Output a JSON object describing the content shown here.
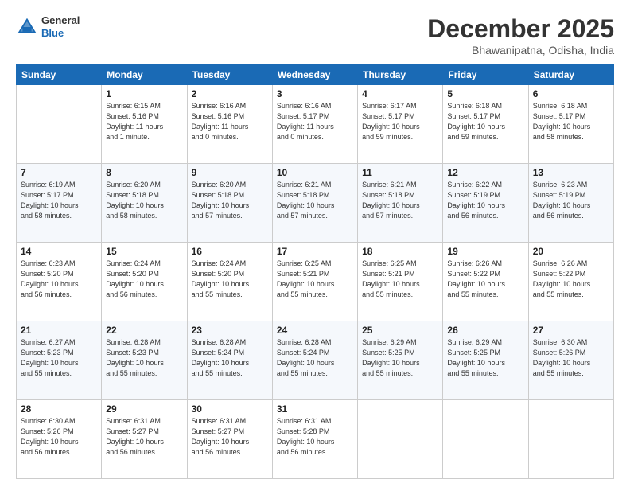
{
  "header": {
    "logo": {
      "line1": "General",
      "line2": "Blue"
    },
    "title": "December 2025",
    "location": "Bhawanipatna, Odisha, India"
  },
  "columns": [
    "Sunday",
    "Monday",
    "Tuesday",
    "Wednesday",
    "Thursday",
    "Friday",
    "Saturday"
  ],
  "weeks": [
    [
      {
        "day": "",
        "info": ""
      },
      {
        "day": "1",
        "info": "Sunrise: 6:15 AM\nSunset: 5:16 PM\nDaylight: 11 hours\nand 1 minute."
      },
      {
        "day": "2",
        "info": "Sunrise: 6:16 AM\nSunset: 5:16 PM\nDaylight: 11 hours\nand 0 minutes."
      },
      {
        "day": "3",
        "info": "Sunrise: 6:16 AM\nSunset: 5:17 PM\nDaylight: 11 hours\nand 0 minutes."
      },
      {
        "day": "4",
        "info": "Sunrise: 6:17 AM\nSunset: 5:17 PM\nDaylight: 10 hours\nand 59 minutes."
      },
      {
        "day": "5",
        "info": "Sunrise: 6:18 AM\nSunset: 5:17 PM\nDaylight: 10 hours\nand 59 minutes."
      },
      {
        "day": "6",
        "info": "Sunrise: 6:18 AM\nSunset: 5:17 PM\nDaylight: 10 hours\nand 58 minutes."
      }
    ],
    [
      {
        "day": "7",
        "info": "Sunrise: 6:19 AM\nSunset: 5:17 PM\nDaylight: 10 hours\nand 58 minutes."
      },
      {
        "day": "8",
        "info": "Sunrise: 6:20 AM\nSunset: 5:18 PM\nDaylight: 10 hours\nand 58 minutes."
      },
      {
        "day": "9",
        "info": "Sunrise: 6:20 AM\nSunset: 5:18 PM\nDaylight: 10 hours\nand 57 minutes."
      },
      {
        "day": "10",
        "info": "Sunrise: 6:21 AM\nSunset: 5:18 PM\nDaylight: 10 hours\nand 57 minutes."
      },
      {
        "day": "11",
        "info": "Sunrise: 6:21 AM\nSunset: 5:18 PM\nDaylight: 10 hours\nand 57 minutes."
      },
      {
        "day": "12",
        "info": "Sunrise: 6:22 AM\nSunset: 5:19 PM\nDaylight: 10 hours\nand 56 minutes."
      },
      {
        "day": "13",
        "info": "Sunrise: 6:23 AM\nSunset: 5:19 PM\nDaylight: 10 hours\nand 56 minutes."
      }
    ],
    [
      {
        "day": "14",
        "info": "Sunrise: 6:23 AM\nSunset: 5:20 PM\nDaylight: 10 hours\nand 56 minutes."
      },
      {
        "day": "15",
        "info": "Sunrise: 6:24 AM\nSunset: 5:20 PM\nDaylight: 10 hours\nand 56 minutes."
      },
      {
        "day": "16",
        "info": "Sunrise: 6:24 AM\nSunset: 5:20 PM\nDaylight: 10 hours\nand 55 minutes."
      },
      {
        "day": "17",
        "info": "Sunrise: 6:25 AM\nSunset: 5:21 PM\nDaylight: 10 hours\nand 55 minutes."
      },
      {
        "day": "18",
        "info": "Sunrise: 6:25 AM\nSunset: 5:21 PM\nDaylight: 10 hours\nand 55 minutes."
      },
      {
        "day": "19",
        "info": "Sunrise: 6:26 AM\nSunset: 5:22 PM\nDaylight: 10 hours\nand 55 minutes."
      },
      {
        "day": "20",
        "info": "Sunrise: 6:26 AM\nSunset: 5:22 PM\nDaylight: 10 hours\nand 55 minutes."
      }
    ],
    [
      {
        "day": "21",
        "info": "Sunrise: 6:27 AM\nSunset: 5:23 PM\nDaylight: 10 hours\nand 55 minutes."
      },
      {
        "day": "22",
        "info": "Sunrise: 6:28 AM\nSunset: 5:23 PM\nDaylight: 10 hours\nand 55 minutes."
      },
      {
        "day": "23",
        "info": "Sunrise: 6:28 AM\nSunset: 5:24 PM\nDaylight: 10 hours\nand 55 minutes."
      },
      {
        "day": "24",
        "info": "Sunrise: 6:28 AM\nSunset: 5:24 PM\nDaylight: 10 hours\nand 55 minutes."
      },
      {
        "day": "25",
        "info": "Sunrise: 6:29 AM\nSunset: 5:25 PM\nDaylight: 10 hours\nand 55 minutes."
      },
      {
        "day": "26",
        "info": "Sunrise: 6:29 AM\nSunset: 5:25 PM\nDaylight: 10 hours\nand 55 minutes."
      },
      {
        "day": "27",
        "info": "Sunrise: 6:30 AM\nSunset: 5:26 PM\nDaylight: 10 hours\nand 55 minutes."
      }
    ],
    [
      {
        "day": "28",
        "info": "Sunrise: 6:30 AM\nSunset: 5:26 PM\nDaylight: 10 hours\nand 56 minutes."
      },
      {
        "day": "29",
        "info": "Sunrise: 6:31 AM\nSunset: 5:27 PM\nDaylight: 10 hours\nand 56 minutes."
      },
      {
        "day": "30",
        "info": "Sunrise: 6:31 AM\nSunset: 5:27 PM\nDaylight: 10 hours\nand 56 minutes."
      },
      {
        "day": "31",
        "info": "Sunrise: 6:31 AM\nSunset: 5:28 PM\nDaylight: 10 hours\nand 56 minutes."
      },
      {
        "day": "",
        "info": ""
      },
      {
        "day": "",
        "info": ""
      },
      {
        "day": "",
        "info": ""
      }
    ]
  ]
}
